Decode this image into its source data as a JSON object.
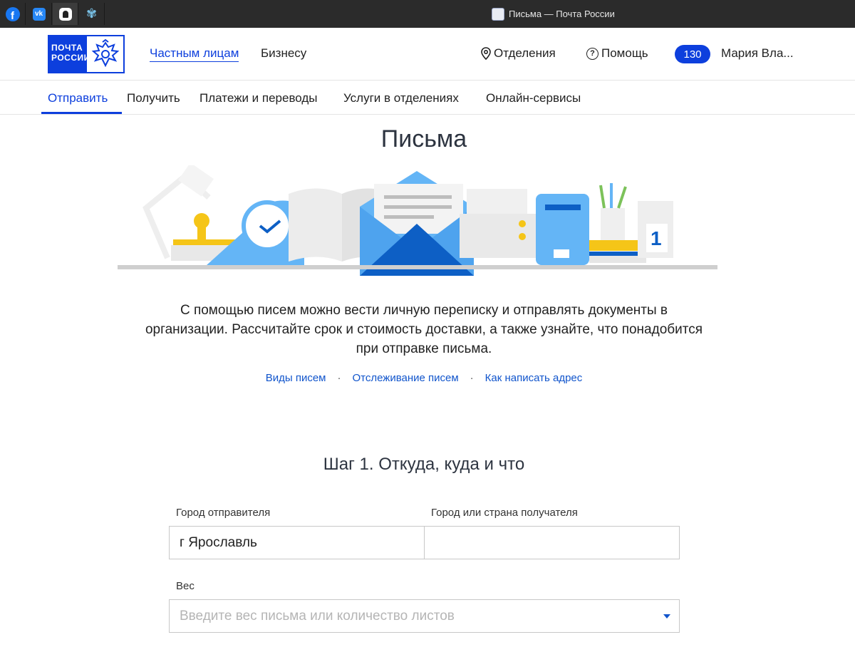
{
  "window": {
    "title": "Письма — Почта России",
    "pinned_tabs": [
      "facebook-icon",
      "vk-icon",
      "app-icon",
      "flower-icon"
    ]
  },
  "header": {
    "logo_line1": "ПОЧТА",
    "logo_line2": "РОССИИ",
    "nav_private": "Частным лицам",
    "nav_business": "Бизнесу",
    "branches": "Отделения",
    "help": "Помощь",
    "badge_count": "130",
    "user_name": "Мария Вла..."
  },
  "subnav": {
    "items": [
      "Отправить",
      "Получить",
      "Платежи и переводы",
      "Услуги в отделениях",
      "Онлайн-сервисы"
    ],
    "active": "Отправить"
  },
  "page": {
    "title": "Письма",
    "intro": "С помощью писем можно вести личную переписку и отправлять документы в организации. Рассчитайте срок и стоимость доставки, а также узнайте, что понадобится при отправке письма.",
    "links": [
      "Виды писем",
      "Отслеживание писем",
      "Как написать адрес"
    ],
    "link_separator": "·"
  },
  "form": {
    "step_title": "Шаг 1. Откуда, куда и что",
    "from_label": "Город отправителя",
    "from_value": "г Ярославль",
    "to_label": "Город или страна получателя",
    "to_value": "",
    "weight_label": "Вес",
    "weight_placeholder": "Введите вес письма или количество листов"
  },
  "hero": {
    "calendar_digit": "1"
  },
  "colors": {
    "brand_blue": "#0d3fdd",
    "link_blue": "#1155cc",
    "accent_light_blue": "#64b5f6",
    "yellow": "#f5c518"
  }
}
